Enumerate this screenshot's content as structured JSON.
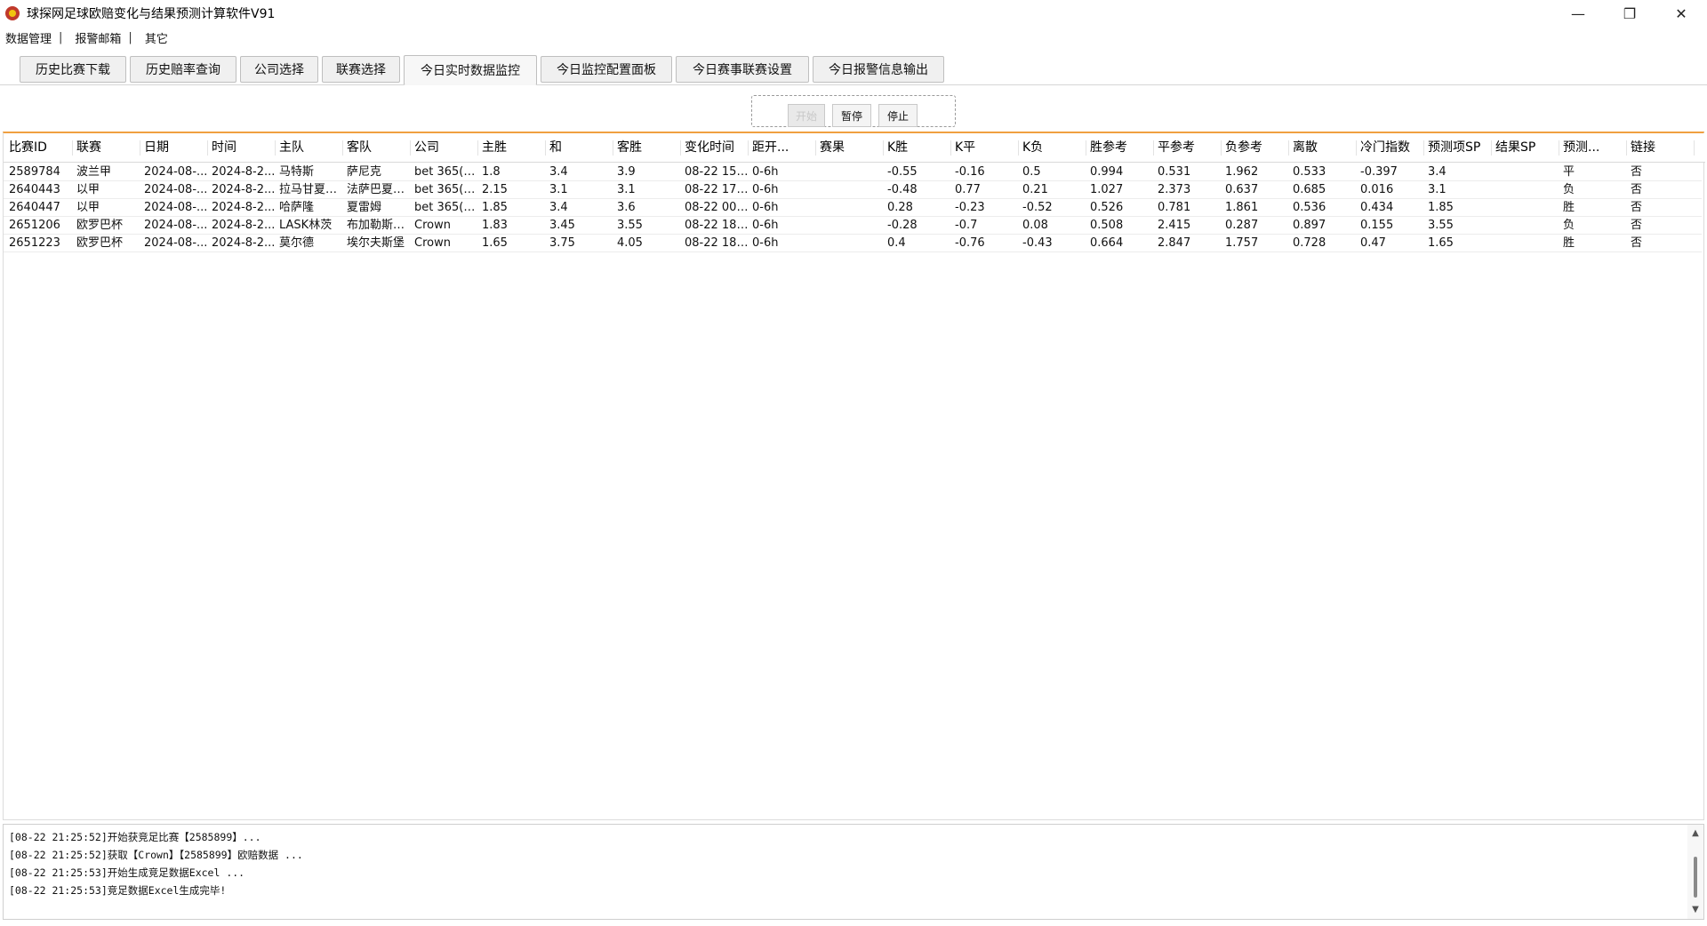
{
  "window": {
    "title": "球探网足球欧赔变化与结果预测计算软件V91",
    "minimize": "—",
    "restore": "❐",
    "close": "✕"
  },
  "menu": {
    "items": [
      "数据管理",
      "报警邮箱",
      "其它"
    ],
    "separator": "|"
  },
  "tabs": [
    "历史比赛下载",
    "历史赔率查询",
    "公司选择",
    "联赛选择",
    "今日实时数据监控",
    "今日监控配置面板",
    "今日赛事联赛设置",
    "今日报警信息输出"
  ],
  "active_tab": 4,
  "controls": {
    "start": "开始",
    "pause": "暂停",
    "stop": "停止"
  },
  "table": {
    "columns": [
      "比赛ID",
      "联赛",
      "日期",
      "时间",
      "主队",
      "客队",
      "公司",
      "主胜",
      "和",
      "客胜",
      "变化时间",
      "距开...",
      "赛果",
      "K胜",
      "K平",
      "K负",
      "胜参考",
      "平参考",
      "负参考",
      "离散",
      "冷门指数",
      "预测项SP",
      "结果SP",
      "预测...",
      "链接"
    ],
    "rows": [
      [
        "2589784",
        "波兰甲",
        "2024-08-...",
        "2024-8-2...",
        "马特斯",
        "萨尼克",
        "bet 365(英...",
        "1.8",
        "3.4",
        "3.9",
        "08-22 15:...",
        "0-6h",
        "",
        "-0.55",
        "-0.16",
        "0.5",
        "0.994",
        "0.531",
        "1.962",
        "0.533",
        "-0.397",
        "3.4",
        "",
        "平",
        "否"
      ],
      [
        "2640443",
        "以甲",
        "2024-08-...",
        "2024-8-2...",
        "拉马甘夏普...",
        "法萨巴夏普...",
        "bet 365(英...",
        "2.15",
        "3.1",
        "3.1",
        "08-22 17:...",
        "0-6h",
        "",
        "-0.48",
        "0.77",
        "0.21",
        "1.027",
        "2.373",
        "0.637",
        "0.685",
        "0.016",
        "3.1",
        "",
        "负",
        "否"
      ],
      [
        "2640447",
        "以甲",
        "2024-08-...",
        "2024-8-2...",
        "哈萨隆",
        "夏雷姆",
        "bet 365(英...",
        "1.85",
        "3.4",
        "3.6",
        "08-22 00:...",
        "0-6h",
        "",
        "0.28",
        "-0.23",
        "-0.52",
        "0.526",
        "0.781",
        "1.861",
        "0.536",
        "0.434",
        "1.85",
        "",
        "胜",
        "否"
      ],
      [
        "2651206",
        "欧罗巴杯",
        "2024-08-...",
        "2024-8-2...",
        "LASK林茨",
        "布加勒斯特...",
        "Crown",
        "1.83",
        "3.45",
        "3.55",
        "08-22 18:...",
        "0-6h",
        "",
        "-0.28",
        "-0.7",
        "0.08",
        "0.508",
        "2.415",
        "0.287",
        "0.897",
        "0.155",
        "3.55",
        "",
        "负",
        "否"
      ],
      [
        "2651223",
        "欧罗巴杯",
        "2024-08-...",
        "2024-8-2...",
        "莫尔德",
        "埃尔夫斯堡",
        "Crown",
        "1.65",
        "3.75",
        "4.05",
        "08-22 18:...",
        "0-6h",
        "",
        "0.4",
        "-0.76",
        "-0.43",
        "0.664",
        "2.847",
        "1.757",
        "0.728",
        "0.47",
        "1.65",
        "",
        "胜",
        "否"
      ]
    ]
  },
  "log": {
    "lines": [
      "[08-22 21:25:52]开始获竞足比赛【2585899】...",
      "[08-22 21:25:52]获取【Crown】【2585899】欧赔数据 ...",
      "[08-22 21:25:53]开始生成竞足数据Excel ...",
      "[08-22 21:25:53]竞足数据Excel生成完毕!"
    ],
    "scroll_up": "▲",
    "scroll_down": "▼"
  }
}
